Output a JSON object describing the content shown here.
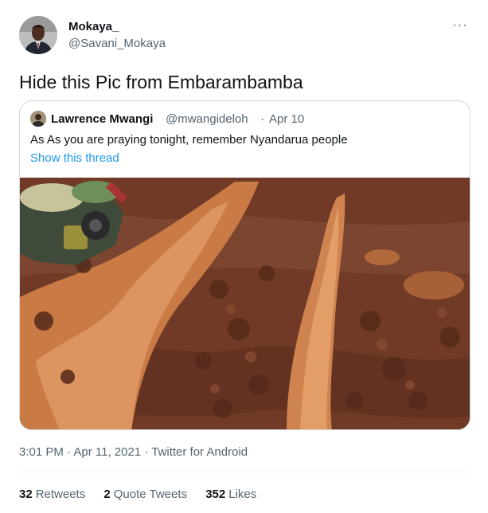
{
  "author": {
    "display_name": "Mokaya_",
    "handle": "@Savani_Mokaya",
    "avatar_icon": "profile-photo-man-in-suit"
  },
  "more_icon": "more-horizontal-icon",
  "more_glyph": "···",
  "tweet_text": "Hide this Pic from Embarambamba",
  "quoted": {
    "display_name": "Lawrence Mwangi",
    "handle": "@mwangideloh",
    "separator": "·",
    "date": "Apr 10",
    "text": "As As you are praying tonight, remember Nyandarua people",
    "show_thread": "Show this thread",
    "media_description_icon": "muddy-road-photo"
  },
  "timestamp": "3:01 PM · Apr 11, 2021 · Twitter for Android",
  "stats": {
    "retweets_count": "32",
    "retweets_label": "Retweets",
    "quotes_count": "2",
    "quotes_label": "Quote Tweets",
    "likes_count": "352",
    "likes_label": "Likes"
  },
  "colors": {
    "text_primary": "#0f1419",
    "text_secondary": "#536471",
    "link": "#1d9bf0",
    "border": "#cfd9de",
    "mud_dark": "#6e3a26",
    "puddle": "#d98a4f"
  }
}
